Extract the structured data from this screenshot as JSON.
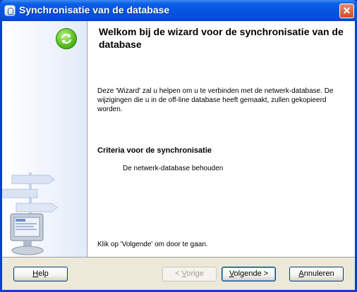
{
  "window": {
    "title": "Synchronisatie van de database",
    "close_glyph": "✕"
  },
  "wizard": {
    "heading": "Welkom bij de wizard voor de synchronisatie van de database",
    "intro": "Deze 'Wizard' zal u helpen om u te verbinden met de netwerk-database. De wijzigingen die u in de off-line database heeft gemaakt, zullen gekopieerd worden.",
    "criteria_heading": "Criteria voor de synchronisatie",
    "criteria_value": "De netwerk-database behouden",
    "footer": "Klik op 'Volgende' om door te gaan."
  },
  "buttons": {
    "help": {
      "label": "Help",
      "accel": "H",
      "rest": "elp"
    },
    "back": {
      "label": "< Vorige",
      "pre": "< ",
      "accel": "V",
      "rest": "orige"
    },
    "next": {
      "label": "Volgende >",
      "accel": "V",
      "rest": "olgende >"
    },
    "cancel": {
      "label": "Annuleren",
      "accel": "A",
      "rest": "nnuleren"
    }
  },
  "icons": {
    "sync": "sync-icon",
    "app": "database-icon",
    "signpost": "signpost-illustration",
    "monitor": "monitor-illustration"
  },
  "colors": {
    "titlebar": "#0654e0",
    "dialog_bg": "#ece9d8",
    "sync_green": "#5cc11f"
  }
}
